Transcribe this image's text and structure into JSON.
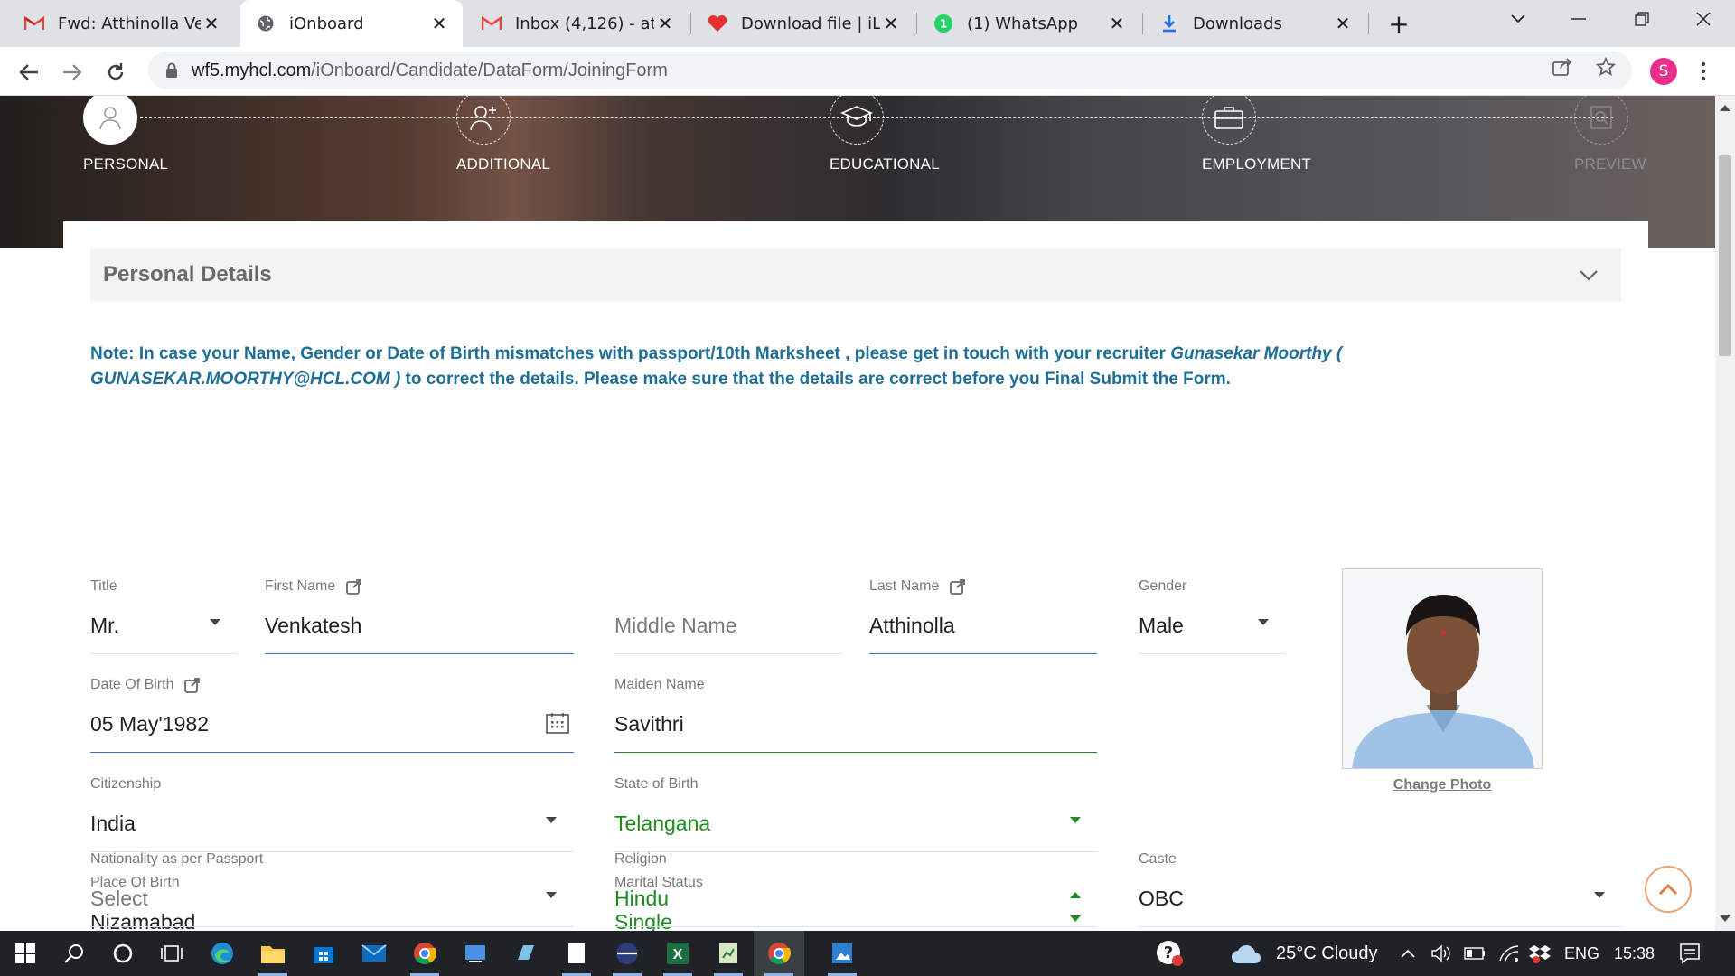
{
  "browser": {
    "tabs": [
      {
        "title": "Fwd: Atthinolla Ven",
        "icon": "gmail-icon"
      },
      {
        "title": "iOnboard",
        "icon": "globe-icon",
        "active": true
      },
      {
        "title": "Inbox (4,126) - atth",
        "icon": "gmail-icon"
      },
      {
        "title": "Download file | iLov",
        "icon": "heart-icon"
      },
      {
        "title": "(1) WhatsApp",
        "icon": "whatsapp-icon"
      },
      {
        "title": "Downloads",
        "icon": "download-icon"
      }
    ],
    "url_host": "wf5.myhcl.com",
    "url_path": "/iOnboard/Candidate/DataForm/JoiningForm",
    "profile_initial": "S"
  },
  "steps": [
    {
      "label": "PERSONAL",
      "state": "current"
    },
    {
      "label": "ADDITIONAL",
      "state": "pending"
    },
    {
      "label": "EDUCATIONAL",
      "state": "pending"
    },
    {
      "label": "EMPLOYMENT",
      "state": "pending"
    },
    {
      "label": "PREVIEW",
      "state": "disabled"
    }
  ],
  "section": {
    "title": "Personal Details"
  },
  "note": {
    "prefix": "Note: In case your Name, Gender or Date of Birth mismatches with passport/10th Marksheet , please get in touch with your recruiter ",
    "recruiter": "Gunasekar Moorthy ( GUNASEKAR.MOORTHY@HCL.COM )",
    "suffix": " to correct the details. Please make sure that the details are correct before you Final Submit the Form."
  },
  "form": {
    "title": {
      "label": "Title",
      "value": "Mr."
    },
    "first_name": {
      "label": "First Name",
      "value": "Venkatesh"
    },
    "middle_name": {
      "placeholder": "Middle Name"
    },
    "last_name": {
      "label": "Last Name",
      "value": "Atthinolla"
    },
    "gender": {
      "label": "Gender",
      "value": "Male"
    },
    "dob": {
      "label": "Date Of Birth",
      "value": "05 May'1982"
    },
    "maiden_name": {
      "label": "Maiden Name",
      "value": "Savithri"
    },
    "citizenship": {
      "label": "Citizenship",
      "value": "India"
    },
    "state_of_birth": {
      "label": "State of Birth",
      "value": "Telangana"
    },
    "place_of_birth": {
      "label": "Place Of Birth",
      "value": "Nizamabad"
    },
    "marital_status": {
      "label": "Marital Status",
      "value": "Single"
    },
    "nationality": {
      "label": "Nationality as per Passport",
      "value": "Select"
    },
    "religion": {
      "label": "Religion",
      "value": "Hindu"
    },
    "caste": {
      "label": "Caste",
      "value": "OBC"
    }
  },
  "photo": {
    "change_label": "Change Photo"
  },
  "taskbar": {
    "weather": "25°C  Cloudy",
    "language": "ENG",
    "time": "15:38"
  },
  "colors": {
    "note_text": "#1d6f95",
    "valid_value": "#1f8a1f",
    "scroll_top_ring": "#f0a070"
  }
}
